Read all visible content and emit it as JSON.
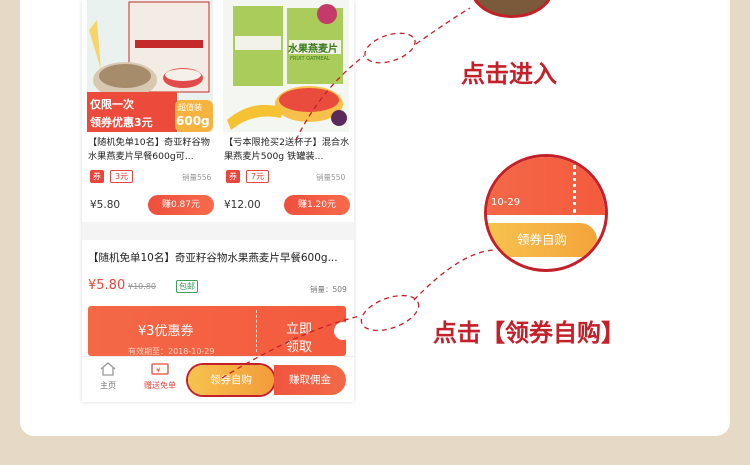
{
  "product1": {
    "title": "【随机免单10名】奇亚籽谷物水果燕麦片早餐600g可...",
    "quan_tag": "券",
    "quan_value": "3元",
    "sales": "销量556",
    "price": "¥5.80",
    "earn": "赚0.87元",
    "banner_line1": "仅限一次",
    "banner_line2": "领券优惠3元",
    "badge_line1": "超值装",
    "badge_line2": "600g"
  },
  "product2": {
    "title": "【亏本限抢买2送杯子】混合水果燕麦片500g 铁罐装...",
    "quan_tag": "券",
    "quan_value": "7元",
    "sales": "销量550",
    "price": "¥12.00",
    "earn": "赚1.20元",
    "can_label": "水果燕麦片",
    "can_sub": "FRUIT OATMEAL"
  },
  "detail": {
    "title": "【随机免单10名】奇亚籽谷物水果燕麦片早餐600g...",
    "price": "¥5.80",
    "orig_price": "¥10.80",
    "tag": "包邮",
    "sales": "销量：509",
    "coupon_value": "¥3优惠券",
    "coupon_valid": "有效期至：2018-10-29",
    "coupon_action_line1": "立即",
    "coupon_action_line2": "领取"
  },
  "bottom_bar": {
    "home": "主页",
    "gift": "赠送免单",
    "claim": "领券自购",
    "earn": "赚取佣金"
  },
  "zoom": {
    "date": "10-29",
    "button": "领券自购"
  },
  "notes": {
    "enter": "点击进入",
    "claim": "点击【领券自购】"
  },
  "colors": {
    "accent": "#ef4f3e",
    "note_red": "#c3202a",
    "gold": "#f6b33f"
  }
}
